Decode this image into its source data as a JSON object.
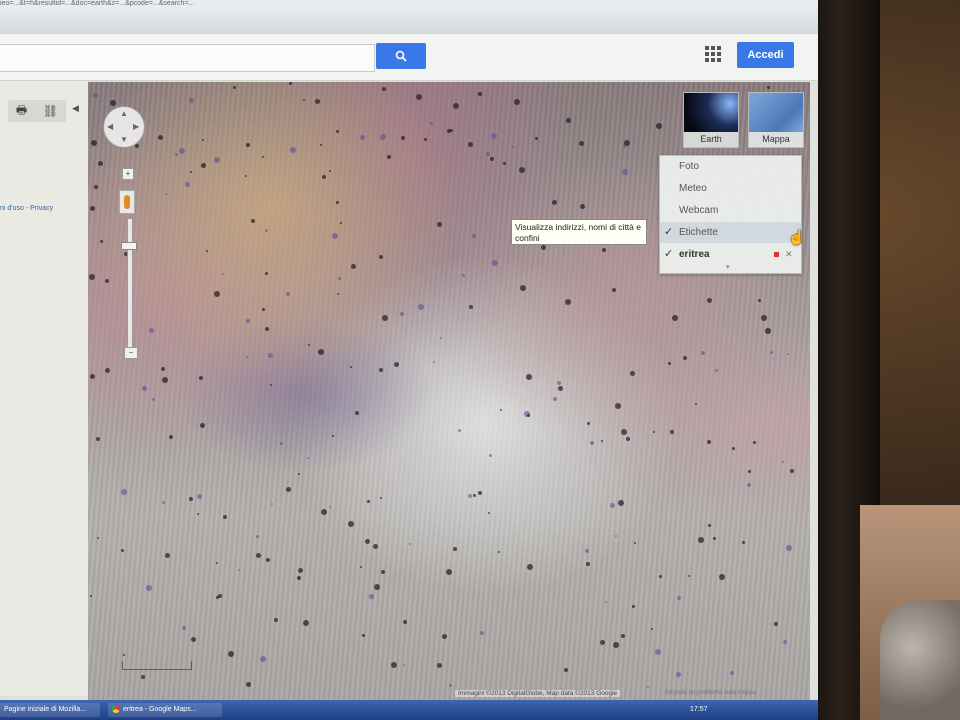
{
  "browser": {
    "url_fragment": "ieo=...&t=h&resultid=...&doc=earth&z=...&pcode=...&search=...",
    "tasks": [
      {
        "label": "Pagine iniziale di Mozilla..."
      },
      {
        "label": "eritrea - Google Maps..."
      }
    ],
    "tray_text": "17:57"
  },
  "header": {
    "search_value": "",
    "signin_label": "Accedi"
  },
  "left_panel": {
    "links_text": "ni d'uso - Privacy"
  },
  "map_types": [
    {
      "label": "Earth"
    },
    {
      "label": "Mappa"
    }
  ],
  "layers_menu": {
    "items": [
      {
        "label": "Foto",
        "checked": false
      },
      {
        "label": "Meteo",
        "checked": false
      },
      {
        "label": "Webcam",
        "checked": false
      },
      {
        "label": "Etichette",
        "checked": true
      },
      {
        "label": "eritrea",
        "checked": true
      }
    ],
    "check_glyph": "✓",
    "close_glyph": "✕"
  },
  "tooltip": {
    "text": "Visualizza indirizzi, nomi di città e confini"
  },
  "attribution": {
    "text": "Immagini ©2013 DigitalGlobe, Map data ©2013 Google",
    "report_text": "Segnala un problema sulla mappa"
  },
  "nav": {
    "zoom_in": "+",
    "zoom_out": "−"
  },
  "colors": {
    "accent_blue": "#3b78e7",
    "taskbar": "#2b4f98",
    "pegman": "#e58d1c"
  }
}
